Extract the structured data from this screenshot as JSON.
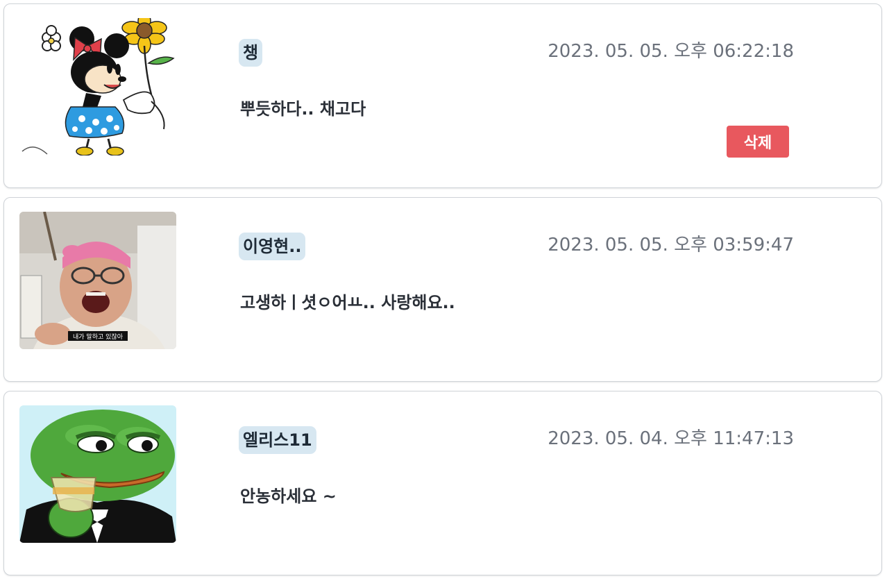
{
  "comments": [
    {
      "avatar": "minnie-mouse-sunflower-avatar",
      "name": "챙",
      "timestamp": "2023. 05. 05. 오후 06:22:18",
      "message": "뿌듯하다.. 채고다",
      "delete_label": "삭제"
    },
    {
      "avatar": "man-pink-headband-photo-avatar",
      "avatar_caption": "내가 말하고 있잖아",
      "name": "이영현..",
      "timestamp": "2023. 05. 05. 오후 03:59:47",
      "message": "고생하ㅣ셧ㅇ어ㅛ.. 사랑해요.."
    },
    {
      "avatar": "pepe-frog-avatar",
      "name": "엘리스11",
      "timestamp": "2023. 05. 04. 오후 11:47:13",
      "message": "안농하세요 ~"
    }
  ],
  "colors": {
    "name_badge_bg": "#d7e7f1",
    "delete_button": "#e8585e",
    "timestamp_text": "#6b717b",
    "card_border": "#cfd3d8"
  }
}
